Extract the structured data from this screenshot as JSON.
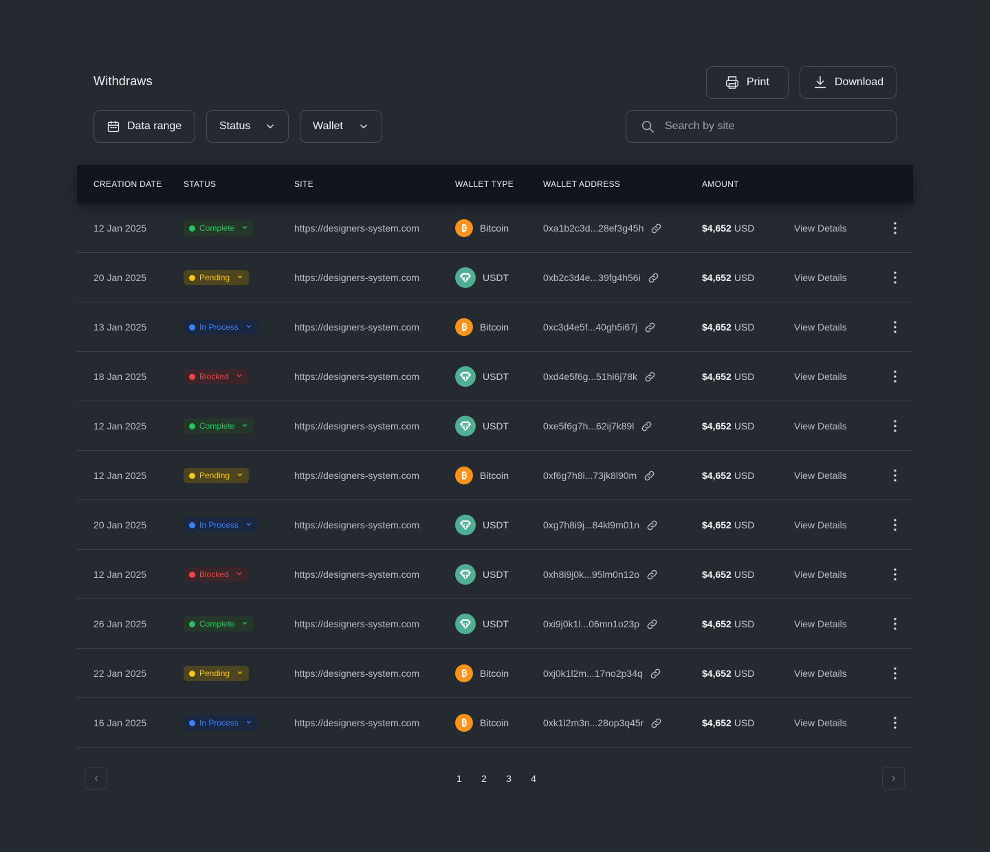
{
  "header": {
    "title": "Withdraws",
    "print_label": "Print",
    "download_label": "Download"
  },
  "filters": {
    "date_label": "Data range",
    "status_label": "Status",
    "wallet_label": "Wallet"
  },
  "search": {
    "placeholder": "Search by site",
    "value": ""
  },
  "table": {
    "columns": [
      "CREATION DATE",
      "STATUS",
      "SITE",
      "WALLET TYPE",
      "WALLET ADDRESS",
      "AMOUNT"
    ],
    "rows": [
      {
        "date": "12 Jan 2025",
        "status": "Complete",
        "status_kind": "complete",
        "site": "https://designers-system.com",
        "wallet": "Bitcoin",
        "wallet_icon": "bitcoin-icon",
        "address": "0xa1b2c3d...28ef3g45h",
        "amount": "$4,652",
        "currency": "USD",
        "action": "View Details"
      },
      {
        "date": "20 Jan 2025",
        "status": "Pending",
        "status_kind": "pending",
        "site": "https://designers-system.com",
        "wallet": "USDT",
        "wallet_icon": "usdt-icon",
        "address": "0xb2c3d4e...39fg4h56i",
        "amount": "$4,652",
        "currency": "USD",
        "action": "View Details"
      },
      {
        "date": "13 Jan 2025",
        "status": "In Process",
        "status_kind": "inprocess",
        "site": "https://designers-system.com",
        "wallet": "Bitcoin",
        "wallet_icon": "bitcoin-icon",
        "address": "0xc3d4e5f...40gh5i67j",
        "amount": "$4,652",
        "currency": "USD",
        "action": "View Details"
      },
      {
        "date": "18 Jan 2025",
        "status": "Blocked",
        "status_kind": "blocked",
        "site": "https://designers-system.com",
        "wallet": "USDT",
        "wallet_icon": "usdt-icon",
        "address": "0xd4e5f6g...51hi6j78k",
        "amount": "$4,652",
        "currency": "USD",
        "action": "View Details"
      },
      {
        "date": "12 Jan 2025",
        "status": "Complete",
        "status_kind": "complete",
        "site": "https://designers-system.com",
        "wallet": "USDT",
        "wallet_icon": "usdt-icon",
        "address": "0xe5f6g7h...62ij7k89l",
        "amount": "$4,652",
        "currency": "USD",
        "action": "View Details"
      },
      {
        "date": "12 Jan 2025",
        "status": "Pending",
        "status_kind": "pending",
        "site": "https://designers-system.com",
        "wallet": "Bitcoin",
        "wallet_icon": "bitcoin-icon",
        "address": "0xf6g7h8i...73jk8l90m",
        "amount": "$4,652",
        "currency": "USD",
        "action": "View Details"
      },
      {
        "date": "20 Jan 2025",
        "status": "In Process",
        "status_kind": "inprocess",
        "site": "https://designers-system.com",
        "wallet": "USDT",
        "wallet_icon": "usdt-icon",
        "address": "0xg7h8i9j...84kl9m01n",
        "amount": "$4,652",
        "currency": "USD",
        "action": "View Details"
      },
      {
        "date": "12 Jan 2025",
        "status": "Blocked",
        "status_kind": "blocked",
        "site": "https://designers-system.com",
        "wallet": "USDT",
        "wallet_icon": "usdt-icon",
        "address": "0xh8i9j0k...95lm0n12o",
        "amount": "$4,652",
        "currency": "USD",
        "action": "View Details"
      },
      {
        "date": "26 Jan 2025",
        "status": "Complete",
        "status_kind": "complete",
        "site": "https://designers-system.com",
        "wallet": "USDT",
        "wallet_icon": "usdt-icon",
        "address": "0xi9j0k1l...06mn1o23p",
        "amount": "$4,652",
        "currency": "USD",
        "action": "View Details"
      },
      {
        "date": "22 Jan 2025",
        "status": "Pending",
        "status_kind": "pending",
        "site": "https://designers-system.com",
        "wallet": "Bitcoin",
        "wallet_icon": "bitcoin-icon",
        "address": "0xj0k1l2m...17no2p34q",
        "amount": "$4,652",
        "currency": "USD",
        "action": "View Details"
      },
      {
        "date": "16 Jan 2025",
        "status": "In Process",
        "status_kind": "inprocess",
        "site": "https://designers-system.com",
        "wallet": "Bitcoin",
        "wallet_icon": "bitcoin-icon",
        "address": "0xk1l2m3n...28op3q45r",
        "amount": "$4,652",
        "currency": "USD",
        "action": "View Details"
      }
    ]
  },
  "pagination": {
    "pages": [
      "1",
      "2",
      "3",
      "4"
    ]
  },
  "colors": {
    "background": "#252a31",
    "header_row": "#12151b",
    "complete": "#22c55e",
    "pending": "#f5c518",
    "in_process": "#3b82f6",
    "blocked": "#ef4444",
    "bitcoin": "#f7931a",
    "usdt": "#4fae93"
  }
}
